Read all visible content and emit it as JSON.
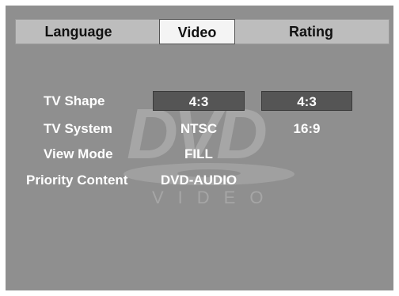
{
  "tabs": [
    {
      "label": "Language",
      "active": false
    },
    {
      "label": "Video",
      "active": true
    },
    {
      "label": "Rating",
      "active": false
    }
  ],
  "rows": [
    {
      "label": "TV Shape",
      "value": "4:3",
      "option": "4:3"
    },
    {
      "label": "TV System",
      "value": "NTSC",
      "option": "16:9"
    },
    {
      "label": "View Mode",
      "value": "FILL"
    },
    {
      "label": "Priority Content",
      "value": "DVD-AUDIO"
    }
  ],
  "watermark": {
    "logo_text": "DVD",
    "sub_text": "VIDEO"
  },
  "colors": {
    "screen_bg": "#8f8f8f",
    "tab_bar": "#bdbdbd",
    "active_tab": "#f4f4f4",
    "highlight_box": "#555555",
    "text": "#ffffff"
  }
}
